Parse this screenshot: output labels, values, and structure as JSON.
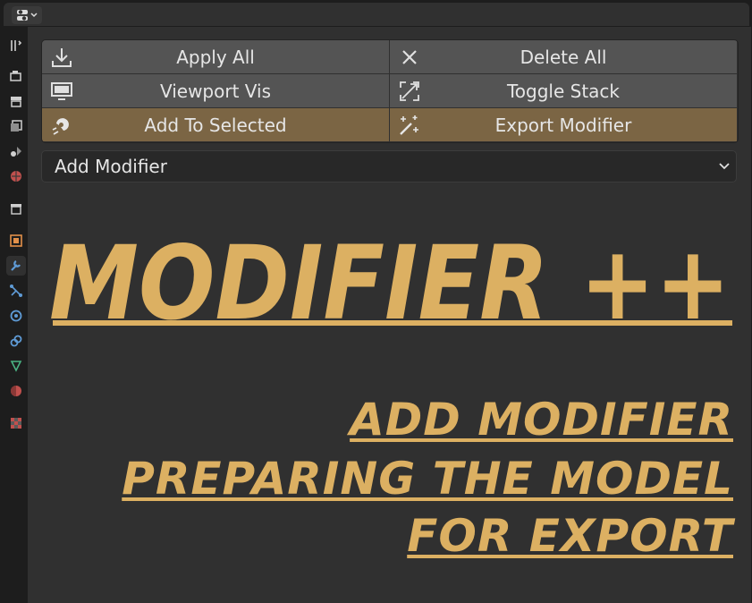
{
  "buttons": {
    "apply_all": "Apply All",
    "delete_all": "Delete All",
    "viewport_vis": "Viewport Vis",
    "toggle_stack": "Toggle Stack",
    "add_to_selected": "Add To Selected",
    "export_modifier": "Export Modifier"
  },
  "dropdown": {
    "label": "Add Modifier"
  },
  "logo": {
    "text": "MODIFIER ++"
  },
  "tagline": {
    "line1": "ADD MODIFIER",
    "line2": "PREPARING THE MODEL",
    "line3": "FOR EXPORT"
  },
  "colors": {
    "accent_gold": "#dcb062",
    "highlight_row": "#7b6544",
    "button_bg": "#545454",
    "panel_bg": "#303030"
  },
  "sidebar_icons": [
    "tool-icon",
    "render-icon",
    "output-icon",
    "view-layer-icon",
    "scene-icon",
    "world-icon",
    "collection-icon",
    "object-icon",
    "modifier-icon",
    "particles-icon",
    "physics-icon",
    "constraints-icon",
    "data-icon",
    "material-icon",
    "texture-icon"
  ]
}
